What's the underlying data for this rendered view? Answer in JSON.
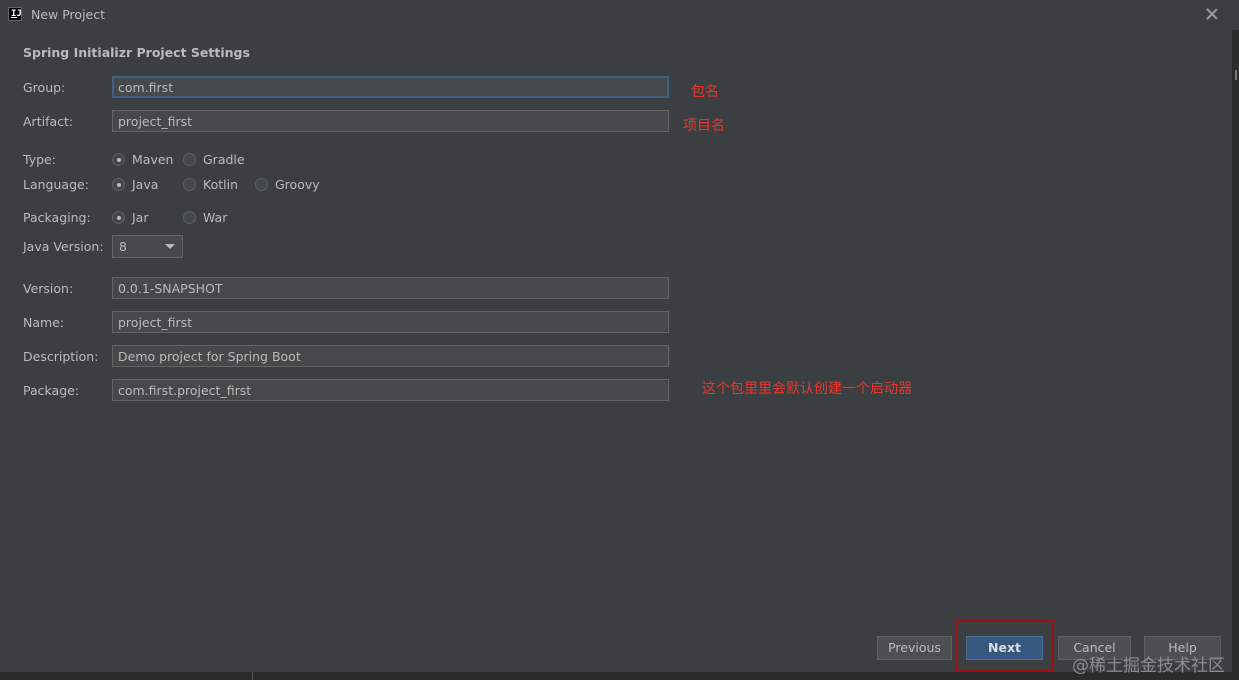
{
  "window": {
    "title": "New Project",
    "icon": "intellij-icon"
  },
  "section_title": "Spring Initializr Project Settings",
  "fields": {
    "group": {
      "label": "Group:",
      "value": "com.first"
    },
    "artifact": {
      "label": "Artifact:",
      "value": "project_first"
    },
    "version": {
      "label": "Version:",
      "value": "0.0.1-SNAPSHOT"
    },
    "name": {
      "label": "Name:",
      "value": "project_first"
    },
    "description": {
      "label": "Description:",
      "value": "Demo project for Spring Boot"
    },
    "package": {
      "label": "Package:",
      "value": "com.first.project_first"
    }
  },
  "type": {
    "label": "Type:",
    "options": [
      "Maven",
      "Gradle"
    ],
    "selected": "Maven"
  },
  "language": {
    "label": "Language:",
    "options": [
      "Java",
      "Kotlin",
      "Groovy"
    ],
    "selected": "Java"
  },
  "packaging": {
    "label": "Packaging:",
    "options": [
      "Jar",
      "War"
    ],
    "selected": "Jar"
  },
  "java_version": {
    "label": "Java Version:",
    "value": "8"
  },
  "annotations": {
    "group_note": "包名",
    "artifact_note": "项目名",
    "package_note": "这个包里里会默认创建一个启动器"
  },
  "buttons": {
    "previous": "Previous",
    "next": "Next",
    "cancel": "Cancel",
    "help": "Help"
  },
  "watermark": "@稀土掘金技术社区",
  "colors": {
    "background": "#3c3f41",
    "primary_button": "#365880",
    "annotation": "#e8352c",
    "highlight_box": "#a01010"
  }
}
